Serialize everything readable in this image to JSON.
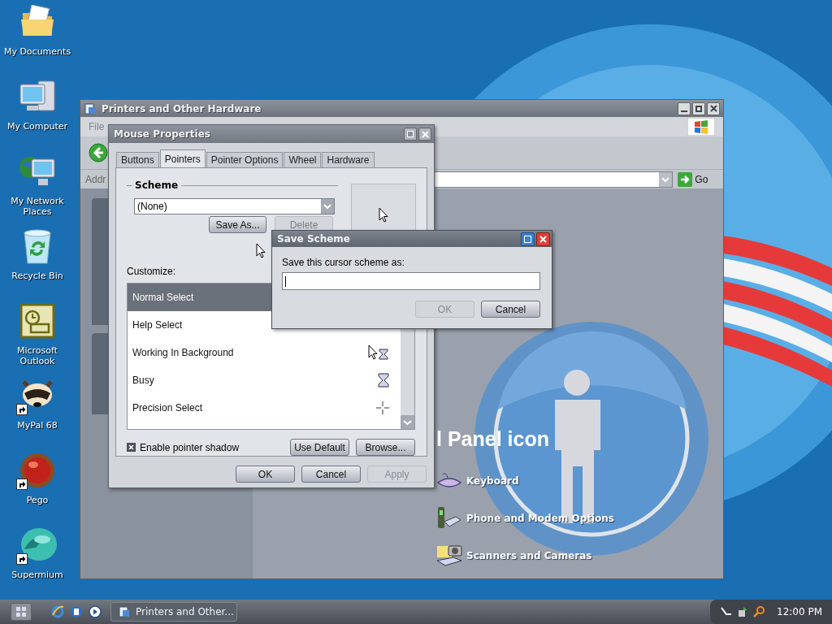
{
  "desktop_icons": [
    {
      "label": "My Documents",
      "kind": "folder",
      "shortcut": false
    },
    {
      "label": "My Computer",
      "kind": "computer",
      "shortcut": false
    },
    {
      "label": "My Network Places",
      "kind": "network",
      "shortcut": false
    },
    {
      "label": "Recycle Bin",
      "kind": "recycle",
      "shortcut": false
    },
    {
      "label": "Microsoft Outlook",
      "kind": "mail",
      "shortcut": false
    },
    {
      "label": "MyPal 68",
      "kind": "raccoon",
      "shortcut": true
    },
    {
      "label": "Pego",
      "kind": "ball",
      "shortcut": true
    },
    {
      "label": "Supermium",
      "kind": "swirl",
      "shortcut": true
    }
  ],
  "explorer": {
    "title": "Printers and Other Hardware",
    "menu": [
      "File"
    ],
    "address_label": "Addr",
    "go": "Go",
    "heading": "l Panel icon",
    "links": [
      {
        "label": "Keyboard",
        "kind": "keyboard"
      },
      {
        "label": "Phone and Modem Options",
        "kind": "phone"
      },
      {
        "label": "Scanners and Cameras",
        "kind": "scanner"
      }
    ]
  },
  "mouse_properties": {
    "title": "Mouse Properties",
    "tabs": [
      {
        "label": "Buttons",
        "selected": false
      },
      {
        "label": "Pointers",
        "selected": true
      },
      {
        "label": "Pointer Options",
        "selected": false
      },
      {
        "label": "Wheel",
        "selected": false
      },
      {
        "label": "Hardware",
        "selected": false
      }
    ],
    "scheme_label": "Scheme",
    "scheme_value": "(None)",
    "save_as": "Save As...",
    "delete": {
      "label": "Delete",
      "disabled": true
    },
    "customize_label": "Customize:",
    "cursors": [
      {
        "name": "Normal Select",
        "selected": true
      },
      {
        "name": "Help Select",
        "selected": false
      },
      {
        "name": "Working In Background",
        "kind": "working",
        "selected": false
      },
      {
        "name": "Busy",
        "kind": "busy",
        "selected": false
      },
      {
        "name": "Precision Select",
        "kind": "cross",
        "selected": false
      }
    ],
    "pointer_shadow": {
      "label": "Enable pointer shadow",
      "checked": true
    },
    "use_default": "Use Default",
    "browse": "Browse...",
    "buttons": [
      {
        "label": "OK",
        "disabled": false
      },
      {
        "label": "Cancel",
        "disabled": false
      },
      {
        "label": "Apply",
        "disabled": true
      }
    ]
  },
  "save_scheme": {
    "title": "Save Scheme",
    "prompt": "Save this cursor scheme as:",
    "buttons": [
      {
        "label": "OK",
        "disabled": true
      },
      {
        "label": "Cancel",
        "disabled": false
      }
    ]
  },
  "taskbar": {
    "task": "Printers and Other...",
    "clock": "12:00 PM"
  }
}
